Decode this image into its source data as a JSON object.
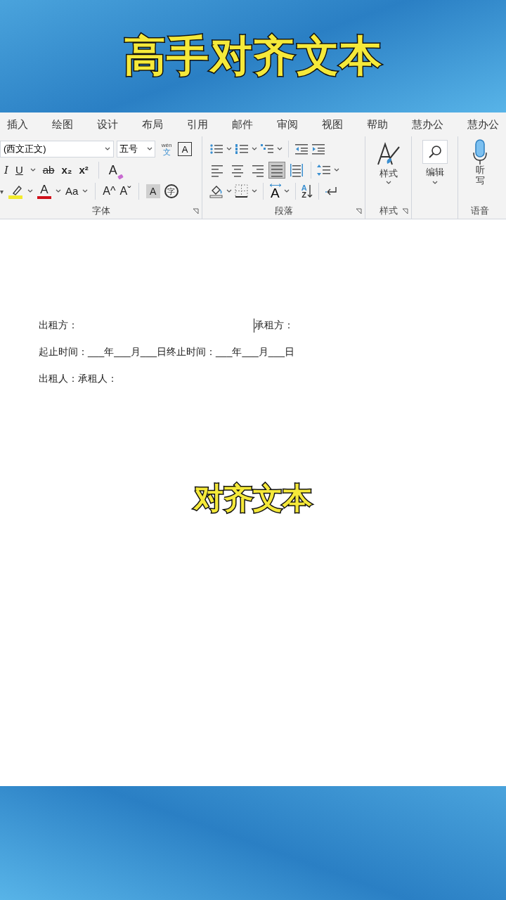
{
  "banner_title": "高手对齐文本",
  "menu_tabs": [
    {
      "label": "插入"
    },
    {
      "label": "绘图"
    },
    {
      "label": "设计"
    },
    {
      "label": "布局"
    },
    {
      "label": "引用"
    },
    {
      "label": "邮件"
    },
    {
      "label": "审阅"
    },
    {
      "label": "视图"
    },
    {
      "label": "帮助"
    },
    {
      "label": "慧办公"
    },
    {
      "label": "慧办公"
    }
  ],
  "font_group": {
    "font_name": "(西文正文)",
    "font_size": "五号",
    "phonetic_top": "wén",
    "phonetic_bottom": "文",
    "char_border": "A",
    "row2": [
      "I",
      "U",
      "ab",
      "x₂",
      "x²"
    ],
    "clear_format": "A",
    "highlight_dropdown": "▾",
    "font_color": "A",
    "change_case": "Aa",
    "grow": "A^",
    "shrink": "Aˇ",
    "char_shading": "A",
    "enclose": "字",
    "label": "字体"
  },
  "paragraph_group": {
    "alignment": [
      {
        "selected": false
      },
      {
        "selected": false
      },
      {
        "selected": false
      },
      {
        "selected": true
      },
      {
        "selected": false
      }
    ],
    "text_direction": "A",
    "sort_top": "A",
    "sort_bottom": "Z",
    "label": "段落"
  },
  "styles_group": {
    "button": "样式",
    "label": "样式"
  },
  "editing_group": {
    "button": "编辑"
  },
  "voice_group": {
    "button": "听写",
    "label": "语音"
  },
  "document": {
    "lessor": "出租方：",
    "lessee": "承租方：",
    "period": "起止时间：___年___月___日终止时间：___年___月___日",
    "signers": "出租人：承租人："
  },
  "caption": "对齐文本"
}
